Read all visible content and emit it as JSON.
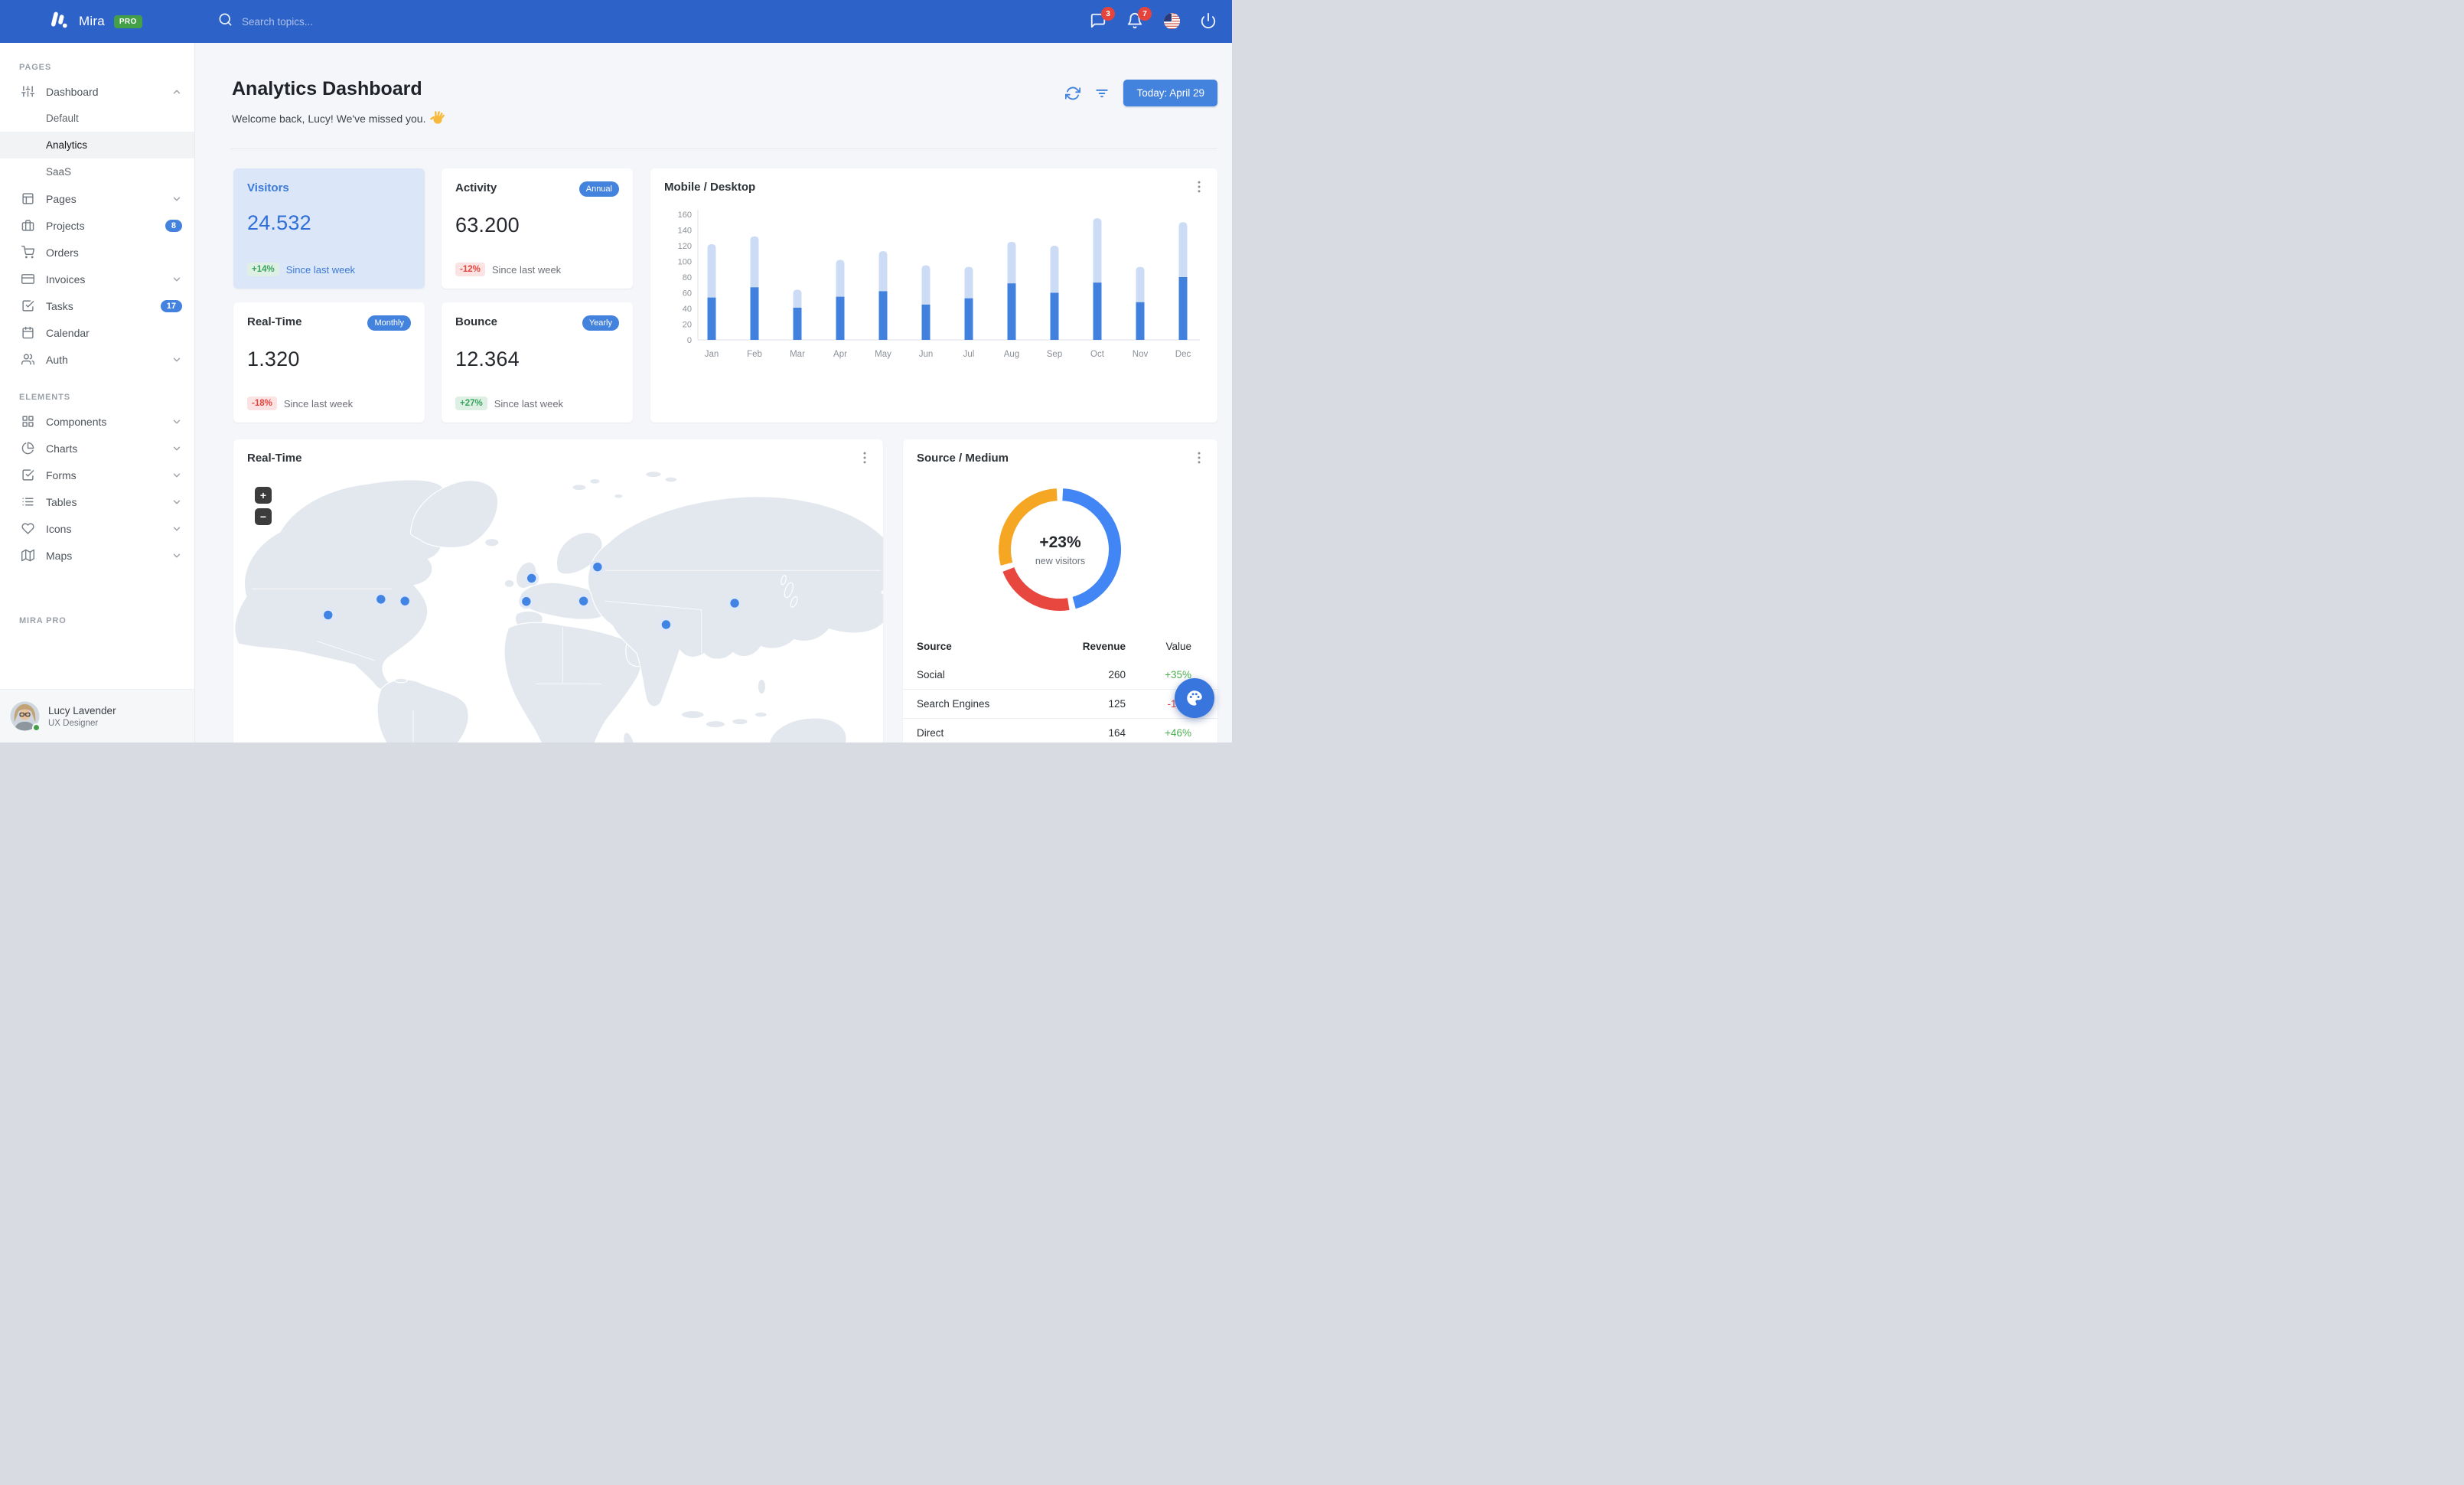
{
  "colors": {
    "navbar": "#2d62c9",
    "primary": "#4382dd",
    "bar_dark": "#4180dd",
    "bar_light": "#ccdcf5",
    "donut_blue": "#4285f4",
    "donut_red": "#e8473f",
    "donut_orange": "#f5a623",
    "green": "#37a45b",
    "red": "#e5443c",
    "map_land": "#e3e8ef"
  },
  "navbar": {
    "brand": "Mira",
    "brand_badge": "PRO",
    "search_placeholder": "Search topics...",
    "messages_badge": "3",
    "notifications_badge": "7",
    "icons": [
      "message-square-icon",
      "bell-icon",
      "us-flag-icon",
      "power-icon"
    ]
  },
  "sidebar": {
    "sections": [
      {
        "label": "PAGES",
        "items": [
          {
            "label": "Dashboard",
            "icon": "sliders",
            "expanded": true,
            "children": [
              "Default",
              "Analytics",
              "SaaS"
            ],
            "active_child": "Analytics"
          },
          {
            "label": "Pages",
            "icon": "layout",
            "chevron": true
          },
          {
            "label": "Projects",
            "icon": "briefcase",
            "badge": "8"
          },
          {
            "label": "Orders",
            "icon": "shopping-cart"
          },
          {
            "label": "Invoices",
            "icon": "credit-card",
            "chevron": true
          },
          {
            "label": "Tasks",
            "icon": "check-square",
            "badge": "17"
          },
          {
            "label": "Calendar",
            "icon": "calendar"
          },
          {
            "label": "Auth",
            "icon": "users",
            "chevron": true
          }
        ]
      },
      {
        "label": "ELEMENTS",
        "items": [
          {
            "label": "Components",
            "icon": "grid",
            "chevron": true
          },
          {
            "label": "Charts",
            "icon": "pie-chart",
            "chevron": true
          },
          {
            "label": "Forms",
            "icon": "check-square",
            "chevron": true
          },
          {
            "label": "Tables",
            "icon": "list",
            "chevron": true
          },
          {
            "label": "Icons",
            "icon": "heart",
            "chevron": true
          },
          {
            "label": "Maps",
            "icon": "map",
            "chevron": true
          }
        ]
      },
      {
        "label": "MIRA PRO",
        "items": []
      }
    ],
    "user": {
      "name": "Lucy Lavender",
      "role": "UX Designer",
      "status": "online"
    }
  },
  "header": {
    "title": "Analytics Dashboard",
    "welcome": "Welcome back, Lucy! We've missed you.",
    "welcome_emoji": "👋",
    "today_button": "Today: April 29",
    "action_icons": [
      "refresh-icon",
      "filter-icon"
    ]
  },
  "stats": [
    {
      "title": "Visitors",
      "badge": "",
      "value": "24.532",
      "delta": "+14%",
      "delta_dir": "up",
      "note": "Since last week",
      "variant": "primary"
    },
    {
      "title": "Activity",
      "badge": "Annual",
      "value": "63.200",
      "delta": "-12%",
      "delta_dir": "down",
      "note": "Since last week",
      "variant": "default"
    },
    {
      "title": "Real-Time",
      "badge": "Monthly",
      "value": "1.320",
      "delta": "-18%",
      "delta_dir": "down",
      "note": "Since last week",
      "variant": "default"
    },
    {
      "title": "Bounce",
      "badge": "Yearly",
      "value": "12.364",
      "delta": "+27%",
      "delta_dir": "up",
      "note": "Since last week",
      "variant": "default"
    }
  ],
  "chart_data": [
    {
      "type": "bar",
      "stacked": true,
      "title": "Mobile / Desktop",
      "categories": [
        "Jan",
        "Feb",
        "Mar",
        "Apr",
        "May",
        "Jun",
        "Jul",
        "Aug",
        "Sep",
        "Oct",
        "Nov",
        "Dec"
      ],
      "series": [
        {
          "name": "Mobile",
          "color": "#4180dd",
          "values": [
            54,
            67,
            41,
            55,
            62,
            45,
            53,
            72,
            60,
            73,
            48,
            80
          ]
        },
        {
          "name": "Desktop",
          "color": "#ccdcf5",
          "values": [
            68,
            65,
            23,
            47,
            51,
            50,
            40,
            53,
            60,
            82,
            45,
            70
          ]
        }
      ],
      "ylabel": "",
      "xlabel": "",
      "ylim": [
        0,
        160
      ],
      "yticks": [
        0,
        20,
        40,
        60,
        80,
        100,
        120,
        140,
        160
      ],
      "grid": false,
      "legend": "none",
      "bar_style": "rounded-top"
    },
    {
      "type": "pie",
      "variant": "donut",
      "title": "Source / Medium",
      "center_value": "+23%",
      "center_label": "new visitors",
      "segments": [
        {
          "name": "Social",
          "value": 260,
          "color": "#4285f4"
        },
        {
          "name": "Search Engines",
          "value": 125,
          "color": "#e8473f"
        },
        {
          "name": "Direct",
          "value": 164,
          "color": "#f5a623"
        }
      ],
      "legend": "none"
    }
  ],
  "realtime_map": {
    "title": "Real-Time",
    "zoom_in": "+",
    "zoom_out": "−",
    "markers": [
      {
        "x": 325,
        "y": 402
      },
      {
        "x": 446,
        "y": 366
      },
      {
        "x": 501,
        "y": 370
      },
      {
        "x": 791,
        "y": 318
      },
      {
        "x": 779,
        "y": 371
      },
      {
        "x": 942,
        "y": 292
      },
      {
        "x": 910,
        "y": 370
      },
      {
        "x": 1099,
        "y": 424
      },
      {
        "x": 1256,
        "y": 375
      }
    ]
  },
  "source_medium": {
    "title": "Source / Medium",
    "table": {
      "headers": [
        "Source",
        "Revenue",
        "Value"
      ],
      "rows": [
        {
          "source": "Social",
          "revenue": "260",
          "value": "+35%",
          "dir": "up"
        },
        {
          "source": "Search Engines",
          "revenue": "125",
          "value": "-12%",
          "dir": "down"
        },
        {
          "source": "Direct",
          "revenue": "164",
          "value": "+46%",
          "dir": "up"
        }
      ]
    }
  }
}
